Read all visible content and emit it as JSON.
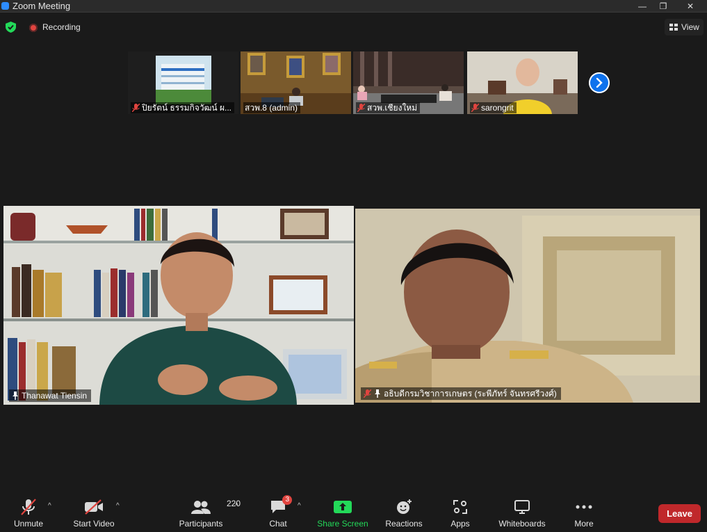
{
  "window": {
    "title": "Zoom Meeting"
  },
  "topbar": {
    "recording_label": "Recording",
    "view_label": "View"
  },
  "thumbnails": [
    {
      "name": "ปิยรัตน์ ธรรมกิจวัฒน์ ผ..."
    },
    {
      "name": "สวพ.8 (admin)"
    },
    {
      "name": "สวพ.เชียงใหม่"
    },
    {
      "name": "sarongrit"
    }
  ],
  "main": {
    "speaker": {
      "name": "Thanawat Tiensin"
    },
    "second": {
      "name": "อธิบดีกรมวิชาการเกษตร (ระพีภัทร์ จันทรศรีวงศ์)"
    }
  },
  "toolbar": {
    "unmute": "Unmute",
    "start_video": "Start Video",
    "participants": "Participants",
    "participants_count": "220",
    "chat": "Chat",
    "chat_badge": "3",
    "share_screen": "Share Screen",
    "reactions": "Reactions",
    "apps": "Apps",
    "whiteboards": "Whiteboards",
    "more": "More",
    "leave": "Leave"
  },
  "colors": {
    "active_speaker_border": "#c9e25a",
    "share_green": "#23d959",
    "leave_red": "#c0282b",
    "accent_blue": "#0e72ed"
  }
}
